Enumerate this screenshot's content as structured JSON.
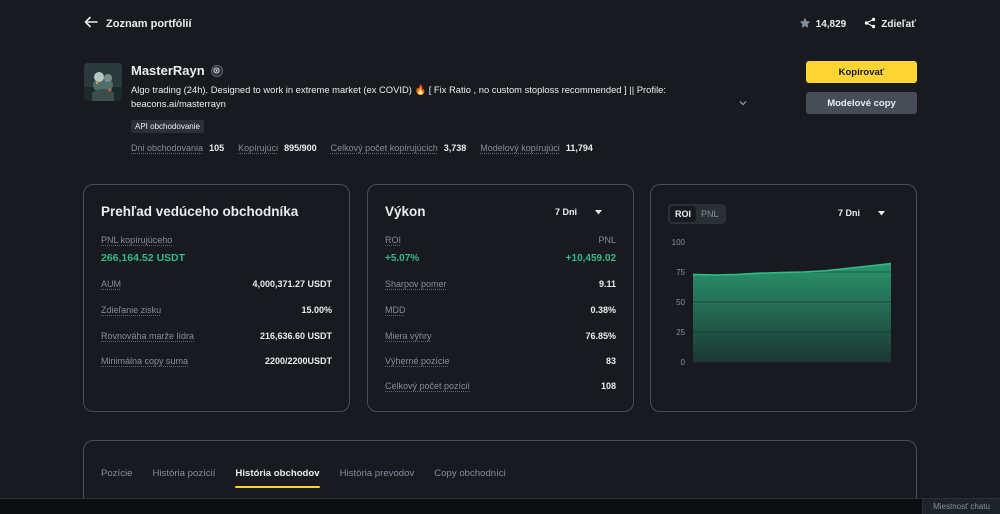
{
  "header": {
    "back_label": "Zoznam portfólií",
    "favorites_count": "14,829",
    "share_label": "Zdieľať"
  },
  "profile": {
    "name": "MasterRayn",
    "description": "Algo trading (24h). Designed to work in extreme market (ex COVID) 🔥 [ Fix Ratio , no custom stoploss recommended ] || Profile: beacons.ai/masterrayn",
    "tag": "API obchodovanie",
    "stats": [
      {
        "label": "Dni obchodovania",
        "value": "105"
      },
      {
        "label": "Kopírujúci",
        "value": "895/900"
      },
      {
        "label": "Celkový počet kopírujúcich",
        "value": "3,738"
      },
      {
        "label": "Modelový kopírujúci",
        "value": "11,794"
      }
    ],
    "copy_button": "Kopírovať",
    "model_copy_button": "Modelové copy"
  },
  "overview": {
    "title": "Prehľad vedúceho obchodníka",
    "pnl_label": "PNL kopírujúceho",
    "pnl_value": "266,164.52 USDT",
    "rows": [
      {
        "label": "AUM",
        "value": "4,000,371.27 USDT"
      },
      {
        "label": "Zdieľanie zisku",
        "value": "15.00%"
      },
      {
        "label": "Rovnováha marže lídra",
        "value": "216,636.60 USDT"
      },
      {
        "label": "Minimálna copy suma",
        "value": "2200/2200USDT"
      }
    ]
  },
  "performance": {
    "title": "Výkon",
    "period": "7 Dni",
    "roi_label": "ROI",
    "pnl_label": "PNL",
    "roi_value": "+5.07%",
    "pnl_value": "+10,459.02",
    "rows": [
      {
        "label": "Sharpov pomer",
        "value": "9.11"
      },
      {
        "label": "MDD",
        "value": "0.38%"
      },
      {
        "label": "Miera výhry",
        "value": "76.85%"
      },
      {
        "label": "Výherné pozície",
        "value": "83"
      },
      {
        "label": "Celkový počet pozícií",
        "value": "108"
      }
    ]
  },
  "chart_panel": {
    "toggle_roi": "ROI",
    "toggle_pnl": "PNL",
    "period": "7 Dni"
  },
  "chart_data": {
    "type": "area",
    "series": [
      {
        "values": [
          73,
          72.5,
          73,
          74,
          74.5,
          75,
          76,
          78,
          80,
          82
        ]
      }
    ],
    "yticks": [
      100,
      75,
      50,
      25,
      0
    ],
    "ylim": [
      0,
      100
    ],
    "grid": true,
    "color": "#2ebd85"
  },
  "tabs": [
    {
      "label": "Pozície"
    },
    {
      "label": "História pozícií"
    },
    {
      "label": "História obchodov"
    },
    {
      "label": "História prevodov"
    },
    {
      "label": "Copy obchodníci"
    }
  ],
  "chat": {
    "label": "Miestnosť chatu"
  },
  "colors": {
    "accent": "#fcd535",
    "positive": "#2ebd85",
    "background": "#181a20"
  }
}
